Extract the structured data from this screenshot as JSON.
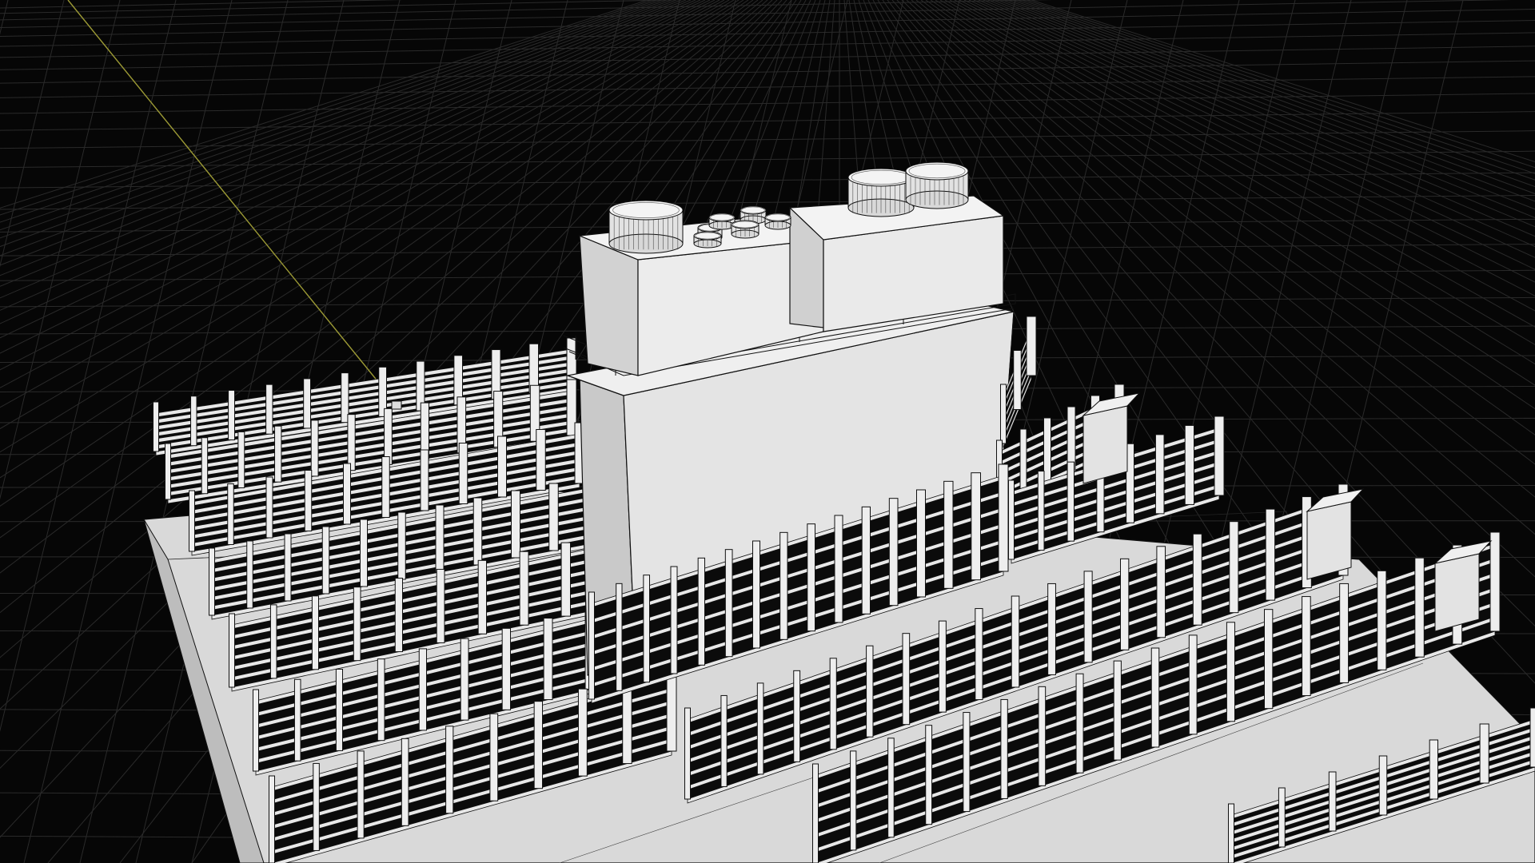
{
  "viewport": {
    "label": "3D viewport",
    "background_color": "#060606",
    "grid_color": "#2a2a2a",
    "axis_color": "#9c9a35",
    "model_fill": "#e6e6e6",
    "model_shade": "#cfcfcf",
    "edge_color": "#111111",
    "display_mode": "shaded-wireframe"
  }
}
